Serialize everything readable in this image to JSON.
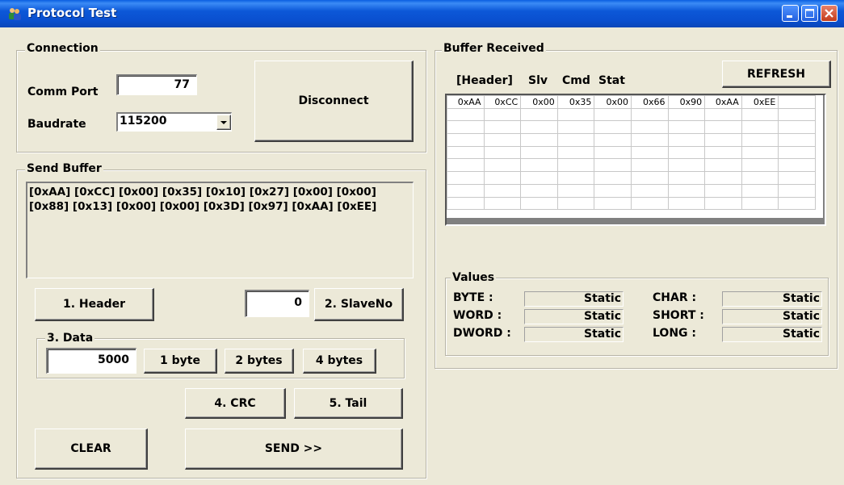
{
  "window": {
    "title": "Protocol Test"
  },
  "connection": {
    "group_label": "Connection",
    "comm_port_label": "Comm Port",
    "comm_port_value": "77",
    "baudrate_label": "Baudrate",
    "baudrate_value": "115200",
    "disconnect_label": "Disconnect"
  },
  "send_buffer": {
    "group_label": "Send Buffer",
    "line1": "[0xAA] [0xCC] [0x00] [0x35] [0x10] [0x27] [0x00] [0x00]",
    "line2": "[0x88] [0x13] [0x00] [0x00] [0x3D] [0x97] [0xAA] [0xEE]",
    "header_button": "1. Header",
    "slave_value": "0",
    "slave_button": "2. SlaveNo",
    "data_group_label": "3. Data",
    "data_value": "5000",
    "byte1_button": "1 byte",
    "byte2_button": "2 bytes",
    "byte4_button": "4 bytes",
    "crc_button": "4. CRC",
    "tail_button": "5. Tail",
    "clear_button": "CLEAR",
    "send_button": "SEND >>"
  },
  "buffer_received": {
    "group_label": "Buffer Received",
    "col_header": "[Header]",
    "col_slv": "Slv",
    "col_cmd": "Cmd",
    "col_stat": "Stat",
    "refresh_button": "REFRESH",
    "rows": [
      [
        "0xAA",
        "0xCC",
        "0x00",
        "0x35",
        "0x00",
        "0x66",
        "0x90",
        "0xAA",
        "0xEE",
        ""
      ],
      [
        "",
        "",
        "",
        "",
        "",
        "",
        "",
        "",
        "",
        ""
      ],
      [
        "",
        "",
        "",
        "",
        "",
        "",
        "",
        "",
        "",
        ""
      ],
      [
        "",
        "",
        "",
        "",
        "",
        "",
        "",
        "",
        "",
        ""
      ],
      [
        "",
        "",
        "",
        "",
        "",
        "",
        "",
        "",
        "",
        ""
      ],
      [
        "",
        "",
        "",
        "",
        "",
        "",
        "",
        "",
        "",
        ""
      ],
      [
        "",
        "",
        "",
        "",
        "",
        "",
        "",
        "",
        "",
        ""
      ],
      [
        "",
        "",
        "",
        "",
        "",
        "",
        "",
        "",
        "",
        ""
      ],
      [
        "",
        "",
        "",
        "",
        "",
        "",
        "",
        "",
        "",
        ""
      ]
    ]
  },
  "values": {
    "group_label": "Values",
    "byte_label": "BYTE :",
    "byte_value": "Static",
    "word_label": "WORD :",
    "word_value": "Static",
    "dword_label": "DWORD :",
    "dword_value": "Static",
    "char_label": "CHAR :",
    "char_value": "Static",
    "short_label": "SHORT :",
    "short_value": "Static",
    "long_label": "LONG :",
    "long_value": "Static"
  },
  "icons": {
    "app": "people-icon",
    "dropdown": "chevron-down-icon"
  }
}
